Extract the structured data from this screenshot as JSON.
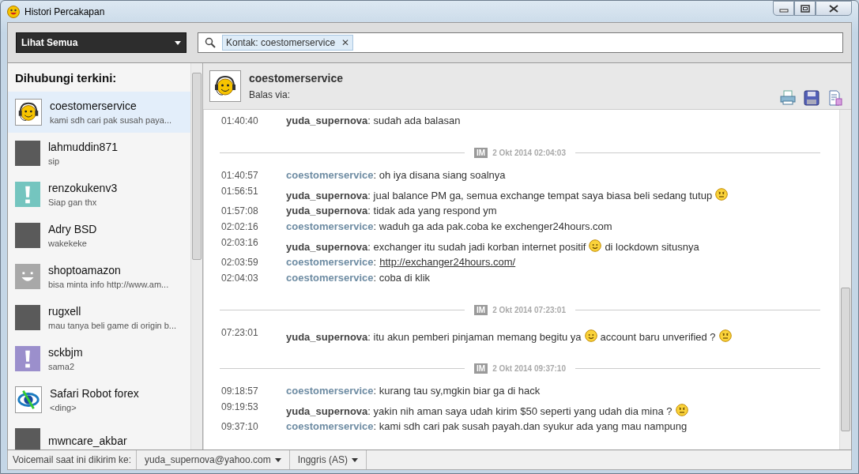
{
  "window": {
    "title": "Histori Percakapan"
  },
  "toolbar": {
    "filter": "Lihat Semua",
    "search_token": "Kontak: coestomerservice",
    "token_close": "✕"
  },
  "sidebar": {
    "heading": "Dihubungi terkini:",
    "items": [
      {
        "name": "coestomerservice",
        "preview": "kami sdh cari pak susah paya...",
        "avatar": {
          "kind": "headset"
        },
        "selected": true
      },
      {
        "name": "lahmuddin871",
        "preview": "sip",
        "avatar": {
          "kind": "photo"
        },
        "selected": false
      },
      {
        "name": "renzokukenv3",
        "preview": "Siap gan thx",
        "avatar": {
          "kind": "alert",
          "color": "#74c5bf"
        },
        "selected": false
      },
      {
        "name": "Adry BSD",
        "preview": "wakekeke",
        "avatar": {
          "kind": "photo"
        },
        "selected": false
      },
      {
        "name": "shoptoamazon",
        "preview": "bisa minta info http://www.am...",
        "avatar": {
          "kind": "default"
        },
        "selected": false
      },
      {
        "name": "rugxell",
        "preview": "mau tanya beli game di origin b...",
        "avatar": {
          "kind": "photo"
        },
        "selected": false
      },
      {
        "name": "sckbjm",
        "preview": "sama2",
        "avatar": {
          "kind": "alert",
          "color": "#9b8fcc"
        },
        "selected": false
      },
      {
        "name": "Safari Robot forex",
        "preview": "<ding>",
        "avatar": {
          "kind": "logo"
        },
        "selected": false
      },
      {
        "name": "mwncare_akbar",
        "avatar": {
          "kind": "photo"
        },
        "selected": false
      }
    ]
  },
  "conversation": {
    "contact": "coestomerservice",
    "reply_via": "Balas via:",
    "messages": [
      {
        "kind": "message",
        "time": "01:40:40",
        "sender": {
          "kind": "self",
          "name": "yuda_supernova"
        },
        "parts": [
          {
            "kind": "text",
            "text": ": sudah ada balasan"
          }
        ]
      },
      {
        "kind": "divider",
        "badge": "IM",
        "date": "2 Okt 2014 02:04:03"
      },
      {
        "kind": "message",
        "time": "01:40:57",
        "sender": {
          "kind": "contact",
          "name": "coestomerservice"
        },
        "parts": [
          {
            "kind": "text",
            "text": ": oh iya disana siang soalnya"
          }
        ]
      },
      {
        "kind": "message",
        "time": "01:56:51",
        "sender": {
          "kind": "self",
          "name": "yuda_supernova"
        },
        "parts": [
          {
            "kind": "text",
            "text": ": jual balance PM ga, semua exchange tempat saya biasa beli sedang tutup"
          },
          {
            "kind": "worried_emoticon"
          }
        ]
      },
      {
        "kind": "message",
        "time": "01:57:08",
        "sender": {
          "kind": "self",
          "name": "yuda_supernova"
        },
        "parts": [
          {
            "kind": "text",
            "text": ": tidak ada yang respond ym"
          }
        ]
      },
      {
        "kind": "message",
        "time": "02:02:16",
        "sender": {
          "kind": "contact",
          "name": "coestomerservice"
        },
        "parts": [
          {
            "kind": "text",
            "text": ": waduh ga ada pak.coba ke exchenger24hours.com"
          }
        ]
      },
      {
        "kind": "message",
        "time": "02:03:16",
        "sender": {
          "kind": "self",
          "name": "yuda_supernova"
        },
        "parts": [
          {
            "kind": "text",
            "text": ": exchanger itu sudah jadi korban internet positif"
          },
          {
            "kind": "smile_emoticon"
          },
          {
            "kind": "text",
            "text": "di lockdown situsnya"
          }
        ]
      },
      {
        "kind": "message",
        "time": "02:03:59",
        "sender": {
          "kind": "contact",
          "name": "coestomerservice"
        },
        "parts": [
          {
            "kind": "text",
            "text": ":"
          },
          {
            "kind": "link",
            "text": "http://exchanger24hours.com/"
          }
        ]
      },
      {
        "kind": "message",
        "time": "02:04:03",
        "sender": {
          "kind": "contact",
          "name": "coestomerservice"
        },
        "parts": [
          {
            "kind": "text",
            "text": ": coba di klik"
          }
        ]
      },
      {
        "kind": "divider",
        "badge": "IM",
        "date": "2 Okt 2014 07:23:01"
      },
      {
        "kind": "message",
        "time": "07:23:01",
        "sender": {
          "kind": "self",
          "name": "yuda_supernova"
        },
        "parts": [
          {
            "kind": "text",
            "text": ": itu akun pemberi pinjaman memang begitu ya"
          },
          {
            "kind": "smile_emoticon"
          },
          {
            "kind": "text",
            "text": "account baru unverified ?"
          },
          {
            "kind": "worried_emoticon"
          }
        ]
      },
      {
        "kind": "divider",
        "badge": "IM",
        "date": "2 Okt 2014 09:37:10"
      },
      {
        "kind": "message",
        "time": "09:18:57",
        "sender": {
          "kind": "contact",
          "name": "coestomerservice"
        },
        "parts": [
          {
            "kind": "text",
            "text": ": kurang tau sy,mgkin biar ga di hack"
          }
        ]
      },
      {
        "kind": "message",
        "time": "09:19:53",
        "sender": {
          "kind": "self",
          "name": "yuda_supernova"
        },
        "parts": [
          {
            "kind": "text",
            "text": ": yakin nih aman saya udah kirim $50 seperti yang udah dia mina ?"
          },
          {
            "kind": "worried_emoticon"
          }
        ]
      },
      {
        "kind": "message",
        "time": "09:37:10",
        "sender": {
          "kind": "contact",
          "name": "coestomerservice"
        },
        "parts": [
          {
            "kind": "text",
            "text": ": kami sdh cari pak susah payah.dan syukur ada yang mau nampung"
          }
        ]
      }
    ]
  },
  "status_bar": {
    "label": "Voicemail saat ini dikirim ke:",
    "email": "yuda_supernova@yahoo.com",
    "language": "Inggris (AS)"
  }
}
